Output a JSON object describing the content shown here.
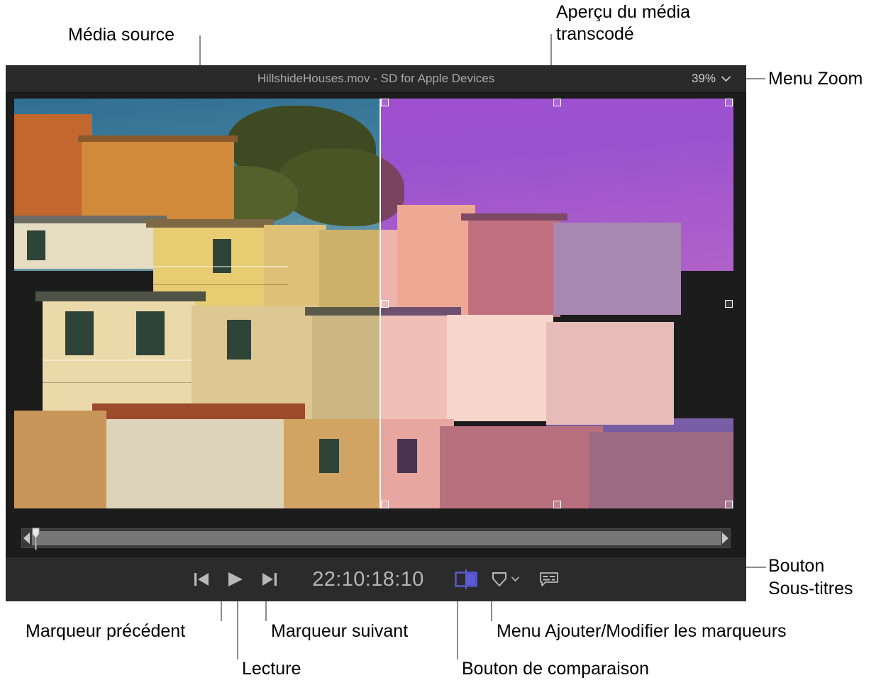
{
  "window": {
    "title": "HillshideHouses.mov - SD for Apple Devices",
    "zoom_level": "39%",
    "zoom_chevron_icon": "chevron-down-icon"
  },
  "transport": {
    "prev_marker_icon": "skip-to-previous-marker-icon",
    "play_icon": "play-icon",
    "next_marker_icon": "skip-to-next-marker-icon",
    "timecode": "22:10:18:10",
    "compare_icon": "split-compare-icon",
    "marker_icon": "marker-shield-icon",
    "marker_chevron_icon": "chevron-down-icon",
    "subtitles_icon": "subtitles-bubble-icon"
  },
  "scrubber": {
    "playhead_icon": "playhead-icon",
    "range_start_icon": "range-start-arrow-icon",
    "range_end_icon": "range-end-arrow-icon"
  },
  "annotations": {
    "media_source": "Média source",
    "transcoded_preview_line1": "Aperçu du média",
    "transcoded_preview_line2": "transcodé",
    "zoom_menu": "Menu Zoom",
    "subtitles_button_line1": "Bouton",
    "subtitles_button_line2": "Sous-titres",
    "previous_marker": "Marqueur précédent",
    "next_marker": "Marqueur suivant",
    "play": "Lecture",
    "compare_button": "Bouton de comparaison",
    "markers_menu": "Menu Ajouter/Modifier les marqueurs"
  },
  "colors": {
    "window_background": "#1c1c1c",
    "title_bar": "#2a2a2a",
    "transport_bar": "#2b2b2b",
    "title_text": "#a8a8a8",
    "timecode_text": "#b5b5b5",
    "compare_accent": "#5b5bd6",
    "leader_line": "#8c8c8c",
    "annotation_text": "#000000",
    "scrubber_fill": "#777777"
  }
}
